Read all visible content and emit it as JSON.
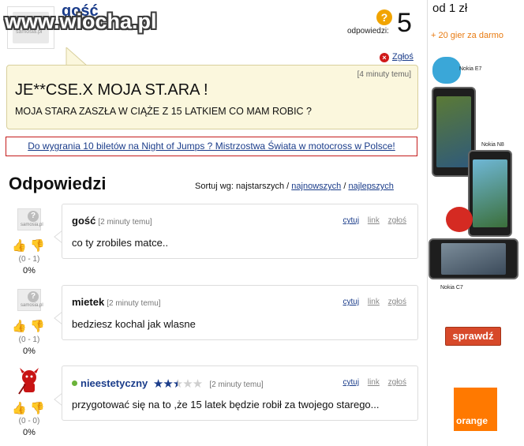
{
  "header": {
    "watermark": "www.wiocha.pl",
    "asker": "gość",
    "avatar_mark": "samosia.pl",
    "answers_label": "odpowiedzi:",
    "answers_count": "5",
    "help_icon": "?",
    "report_label": "Zgłoś"
  },
  "question": {
    "time": "[4 minuty temu]",
    "title": "JE**CSE.X MOJA ST.ARA !",
    "body": "MOJA STARA ZASZŁA W CIĄŻE Z 15 LATKIEM CO MAM ROBIC ?"
  },
  "promo": {
    "text": "Do wygrania 10 biletów na Night of Jumps ? Mistrzostwa Świata w motocross w Polsce!"
  },
  "answers_section": {
    "title": "Odpowiedzi",
    "sort_prefix": "Sortuj wg: najstarszych /",
    "sort_newest": "najnowszych",
    "sep": "/",
    "sort_best": "najlepszych"
  },
  "answers": [
    {
      "name": "gość",
      "time": "[2 minuty temu]",
      "text": "co ty zrobiles matce..",
      "score": "(0 - 1)",
      "pct": "0%",
      "quote": "cytuj",
      "link": "link",
      "report": "zgłoś"
    },
    {
      "name": "mietek",
      "time": "[2 minuty temu]",
      "text": "bedziesz kochal jak wlasne",
      "score": "(0 - 1)",
      "pct": "0%",
      "quote": "cytuj",
      "link": "link",
      "report": "zgłoś"
    },
    {
      "name": "nieestetyczny",
      "time": "[2 minuty temu]",
      "text": "przygotować się na to ,że 15 latek będzie robił za twojego starego...",
      "score": "(0 - 0)",
      "pct": "0%",
      "quote": "cytuj",
      "link": "link",
      "report": "zgłoś",
      "rating_stars": 2.5,
      "rating_max": 5
    }
  ],
  "sidebar": {
    "ad_head": "od 1 zł",
    "games": "+ 20 gier za darmo",
    "phone_1": "Nokia E7",
    "phone_2": "Nokia N8",
    "phone_3": "Nokia C7",
    "check_button": "sprawdź",
    "brand": "orange"
  },
  "colors": {
    "link": "#1a3c8a",
    "question_bg": "#fbf7dd",
    "promo_border": "#c41b1b",
    "accent_orange": "#ff7900",
    "check_button": "#d7492a"
  },
  "icons": [
    "help-icon",
    "close-icon",
    "thumb-up-icon",
    "thumb-down-icon",
    "online-icon",
    "star-icon"
  ]
}
